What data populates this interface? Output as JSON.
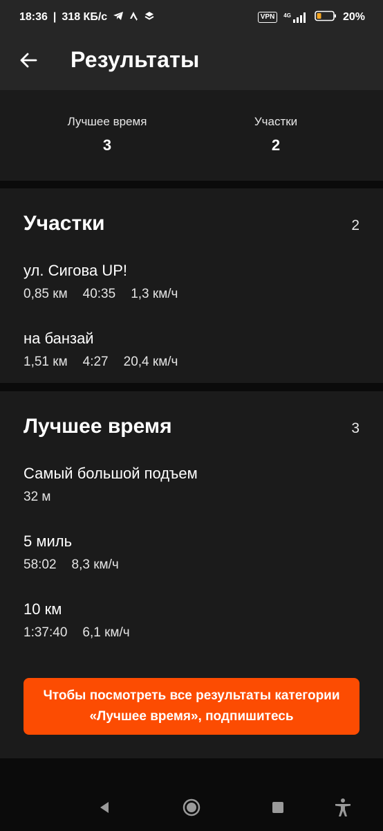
{
  "status_bar": {
    "time": "18:36",
    "speed": "318 КБ/с",
    "vpn": "VPN",
    "network": "4G",
    "battery": "20%"
  },
  "header": {
    "title": "Результаты",
    "back_icon": "arrow-left-icon"
  },
  "summary": {
    "best_time": {
      "label": "Лучшее время",
      "value": "3"
    },
    "segments": {
      "label": "Участки",
      "value": "2"
    }
  },
  "segments_section": {
    "title": "Участки",
    "count": "2",
    "items": [
      {
        "name": "ул. Сигова UP!",
        "distance": "0,85 км",
        "time": "40:35",
        "speed": "1,3 км/ч"
      },
      {
        "name": "на банзай",
        "distance": "1,51 км",
        "time": "4:27",
        "speed": "20,4 км/ч"
      }
    ]
  },
  "best_section": {
    "title": "Лучшее время",
    "count": "3",
    "items": [
      {
        "name": "Самый большой подъем",
        "value": "32 м"
      },
      {
        "name": "5 миль",
        "time": "58:02",
        "speed": "8,3 км/ч"
      },
      {
        "name": "10 км",
        "time": "1:37:40",
        "speed": "6,1 км/ч"
      }
    ],
    "subscribe_label": "Чтобы посмотреть все результаты категории «Лучшее время», подпишитесь"
  },
  "colors": {
    "accent": "#fc4c02",
    "card": "#1b1b1b",
    "header": "#262626",
    "background": "#0b0b0b"
  }
}
